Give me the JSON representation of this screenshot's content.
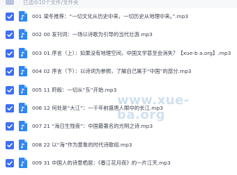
{
  "header": {
    "text": "已选中10个文件/文件夹"
  },
  "files": [
    {
      "name": "001 梁冬推荐：“一切文化从历史中来，一切历史从地理中来。”.mp3"
    },
    {
      "name": "002 00 发刊词：一场以诗歌为引导的当代壮游.mp3"
    },
    {
      "name": "003 01 序言（上）：如果没有地理空间，中国文学甚至会消失？【xue-b a.org】.mp3"
    },
    {
      "name": "004 02 序言（下）：以诗词为参照，了解自己属于“中国”的部分.mp3"
    },
    {
      "name": "005 11 莳般：一切从“东”开始.mp3"
    },
    {
      "name": "006 12 何处是“大江”：一千年前盛唐人眼中的长江.mp3"
    },
    {
      "name": "007 21 “海日生残夜”：中国最著名的光明之诗.mp3"
    },
    {
      "name": "008 22 以“海”作为意象的时代诗歌组.mp3"
    },
    {
      "name": "009 31 中国人的诗意栖居：《春江花月夜》的一片江天.mp3"
    }
  ],
  "watermark": "www.xue-ba.org",
  "colors": {
    "checkbox": "#3d6ef5",
    "file_icon": "#2f86f6"
  }
}
